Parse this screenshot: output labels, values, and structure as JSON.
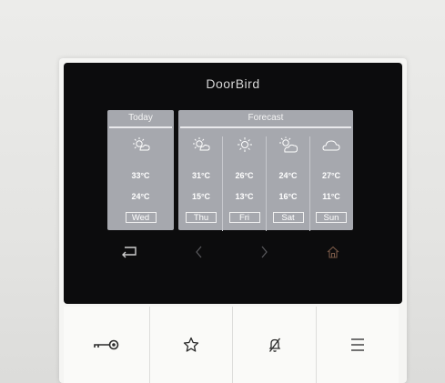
{
  "brand": "DoorBird",
  "today": {
    "label": "Today",
    "icon": "sun-cloud-icon",
    "high": "33°C",
    "low": "24°C",
    "day": "Wed"
  },
  "forecast": {
    "label": "Forecast",
    "days": [
      {
        "icon": "sun-cloud-icon",
        "high": "31°C",
        "low": "15°C",
        "day": "Thu"
      },
      {
        "icon": "sun-icon",
        "high": "26°C",
        "low": "13°C",
        "day": "Fri"
      },
      {
        "icon": "sun-cloud-icon",
        "high": "24°C",
        "low": "16°C",
        "day": "Sat"
      },
      {
        "icon": "cloud-icon",
        "high": "27°C",
        "low": "11°C",
        "day": "Sun"
      }
    ]
  },
  "nav": {
    "back_icon": "return-arrow-icon",
    "prev_icon": "chevron-left-icon",
    "next_icon": "chevron-right-icon",
    "home_icon": "home-icon"
  },
  "buttons": [
    {
      "icon": "key-icon"
    },
    {
      "icon": "star-icon"
    },
    {
      "icon": "bell-muted-icon"
    },
    {
      "icon": "menu-icon"
    }
  ]
}
